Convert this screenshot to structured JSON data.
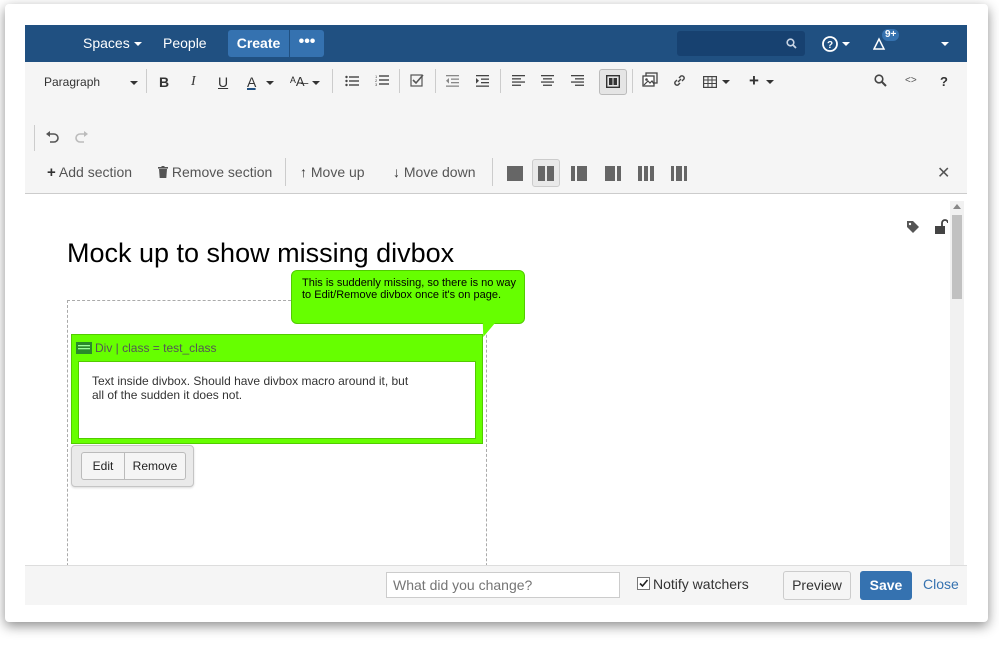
{
  "nav": {
    "spaces": "Spaces",
    "people": "People",
    "create": "Create",
    "more": "•••",
    "notification_badge": "9+"
  },
  "toolbar": {
    "paragraph": "Paragraph",
    "bold": "B",
    "italic": "I",
    "underline": "U",
    "text_color": "A",
    "code": "<>",
    "help": "?",
    "add_section": "Add section",
    "remove_section": "Remove section",
    "move_up": "Move up",
    "move_down": "Move down",
    "close": "✕"
  },
  "page": {
    "title": "Mock up to show missing divbox"
  },
  "divbox": {
    "header": "Div | class = test_class",
    "text": "Text inside divbox. Should have divbox macro around it, but all of the sudden it does not."
  },
  "popup": {
    "edit": "Edit",
    "remove": "Remove"
  },
  "callout": {
    "text": "This is suddenly missing, so there is no way to Edit/Remove divbox once it's on page."
  },
  "footer": {
    "comment_placeholder": "What did you change?",
    "notify_label": "Notify watchers",
    "notify_checked": true,
    "preview": "Preview",
    "save": "Save",
    "close": "Close"
  },
  "colors": {
    "nav_bg": "#205081",
    "accent": "#3572b0",
    "highlight_green": "#66ff00"
  }
}
